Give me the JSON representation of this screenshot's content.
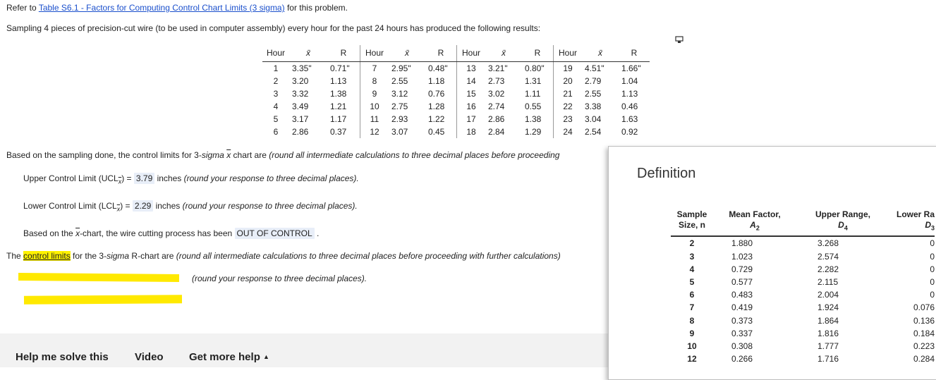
{
  "intro": {
    "prefix": "Refer to ",
    "link": "Table S6.1 - Factors for Computing Control Chart Limits (3 sigma)",
    "suffix": " for this problem."
  },
  "problem_statement": "Sampling 4 pieces of precision-cut wire (to be used in computer assembly) every hour for the past 24 hours has produced the following results:",
  "data_table": {
    "headers": [
      "Hour",
      "x̄",
      "R"
    ],
    "groups": [
      [
        [
          "1",
          "3.35\"",
          "0.71\""
        ],
        [
          "2",
          "3.20",
          "1.13"
        ],
        [
          "3",
          "3.32",
          "1.38"
        ],
        [
          "4",
          "3.49",
          "1.21"
        ],
        [
          "5",
          "3.17",
          "1.17"
        ],
        [
          "6",
          "2.86",
          "0.37"
        ]
      ],
      [
        [
          "7",
          "2.95\"",
          "0.48\""
        ],
        [
          "8",
          "2.55",
          "1.18"
        ],
        [
          "9",
          "3.12",
          "0.76"
        ],
        [
          "10",
          "2.75",
          "1.28"
        ],
        [
          "11",
          "2.93",
          "1.22"
        ],
        [
          "12",
          "3.07",
          "0.45"
        ]
      ],
      [
        [
          "13",
          "3.21\"",
          "0.80\""
        ],
        [
          "14",
          "2.73",
          "1.31"
        ],
        [
          "15",
          "3.02",
          "1.11"
        ],
        [
          "16",
          "2.74",
          "0.55"
        ],
        [
          "17",
          "2.86",
          "1.38"
        ],
        [
          "18",
          "2.84",
          "1.29"
        ]
      ],
      [
        [
          "19",
          "4.51\"",
          "1.66\""
        ],
        [
          "20",
          "2.79",
          "1.04"
        ],
        [
          "21",
          "2.55",
          "1.13"
        ],
        [
          "22",
          "3.38",
          "0.46"
        ],
        [
          "23",
          "3.04",
          "1.63"
        ],
        [
          "24",
          "2.54",
          "0.92"
        ]
      ]
    ]
  },
  "xbar_chart": {
    "q_prefix": "Based on the sampling done, the control limits for 3-",
    "q_sigma": "sigma",
    "q_middle": " chart are ",
    "q_note": "(round all intermediate calculations to three decimal places before proceeding",
    "ucl_label": "Upper Control Limit (UCL",
    "ucl_value": "3.79",
    "ucl_unit": "inches",
    "ucl_note": "(round your response to three decimal places).",
    "lcl_label": "Lower Control Limit (LCL",
    "lcl_value": "2.29",
    "lcl_unit": "inches",
    "lcl_note": "(round your response to three decimal places).",
    "process_prefix": "Based on the ",
    "process_suffix": "-chart, the wire cutting process has been",
    "process_answer": "OUT OF CONTROL"
  },
  "r_chart": {
    "prefix": "The ",
    "highlight": "control limits",
    "middle": " for the 3-",
    "sigma": "sigma",
    "after_sigma": " R-chart are ",
    "note": "(round all intermediate calculations to three decimal places before proceeding with further calculations)",
    "round_note": "(round your response to three decimal places)."
  },
  "definition": {
    "title": "Definition",
    "headers": {
      "sample": [
        "Sample",
        "Size, n"
      ],
      "mean": [
        "Mean Factor,",
        "A",
        "2"
      ],
      "upper": [
        "Upper Range,",
        "D",
        "4"
      ],
      "lower": [
        "Lower Ra",
        "D",
        "3"
      ]
    },
    "rows": [
      [
        "2",
        "1.880",
        "3.268",
        "0"
      ],
      [
        "3",
        "1.023",
        "2.574",
        "0"
      ],
      [
        "4",
        "0.729",
        "2.282",
        "0"
      ],
      [
        "5",
        "0.577",
        "2.115",
        "0"
      ],
      [
        "6",
        "0.483",
        "2.004",
        "0"
      ],
      [
        "7",
        "0.419",
        "1.924",
        "0.076"
      ],
      [
        "8",
        "0.373",
        "1.864",
        "0.136"
      ],
      [
        "9",
        "0.337",
        "1.816",
        "0.184"
      ],
      [
        "10",
        "0.308",
        "1.777",
        "0.223"
      ],
      [
        "12",
        "0.266",
        "1.716",
        "0.284"
      ]
    ]
  },
  "footer": {
    "help": "Help me solve this",
    "video": "Video",
    "more": "Get more help"
  },
  "colors": {
    "link": "#1a4fcc",
    "highlight": "#fff200",
    "answer_bg": "#e8eef8"
  }
}
